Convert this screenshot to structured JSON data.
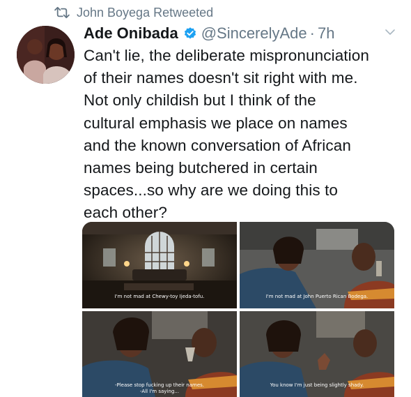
{
  "retweet": {
    "icon": "retweet-icon",
    "label": "John Boyega Retweeted"
  },
  "author": {
    "name": "Ade Onibada",
    "handle": "@SincerelyAde",
    "separator": "·",
    "time": "7h",
    "verified_icon": "verified-badge-icon"
  },
  "tweet": {
    "lines": [
      "Can't lie, the deliberate mispronunciation",
      "of their names doesn't sit right with me.",
      "Not only childish but I think of the",
      "cultural emphasis we place on names",
      "and the known conversation of African",
      "names being butchered in certain",
      "spaces...so why are we doing this to",
      "each other?"
    ]
  },
  "media": {
    "captions": [
      [
        "I'm not mad at Chewy-toy Ijeda-tofu."
      ],
      [
        "I'm not mad at John Puerto Rican Bodega."
      ],
      [
        "-Please stop fucking up their names.",
        "-All I'm saying..."
      ],
      [
        "You know I'm just being slightly shady."
      ]
    ]
  },
  "colors": {
    "text": "#14171a",
    "muted": "#657786",
    "verified": "#1da1f2"
  }
}
